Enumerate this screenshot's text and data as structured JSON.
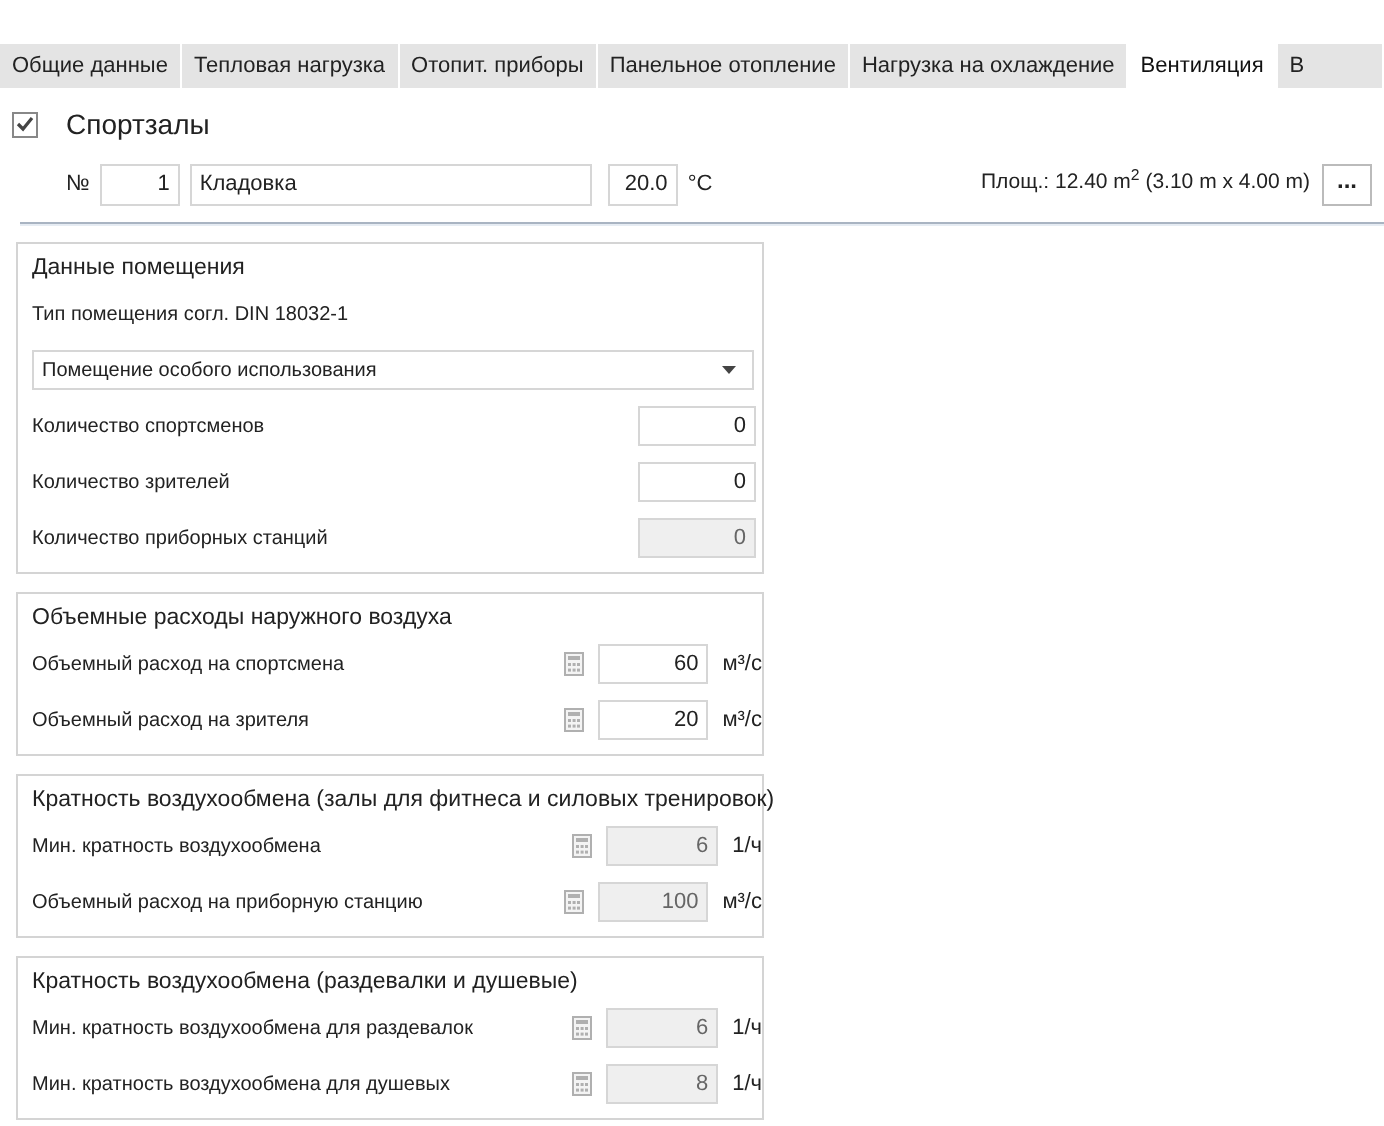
{
  "tabs": [
    {
      "label": "Общие данные",
      "selected": false
    },
    {
      "label": "Тепловая нагрузка",
      "selected": false
    },
    {
      "label": "Отопит. приборы",
      "selected": false
    },
    {
      "label": "Панельное отопление",
      "selected": false
    },
    {
      "label": "Нагрузка на охлаждение",
      "selected": false
    },
    {
      "label": "Вентиляция",
      "selected": true
    },
    {
      "label": "В",
      "selected": false
    }
  ],
  "category": {
    "label": "Спортзалы",
    "checked": true
  },
  "room": {
    "number_label": "№",
    "number": "1",
    "name": "Кладовка",
    "temperature": "20.0",
    "temperature_unit": "°C",
    "area": "Площ.: 12.40  m$^{2}$ (3.10 m x 4.00 m)",
    "more_button": "..."
  },
  "sections": [
    {
      "title": "Данные помещения",
      "rows": [
        {
          "kind": "text",
          "label": "Тип помещения согл. DIN 18032-1"
        },
        {
          "kind": "dropdown",
          "value": "Помещение особого использования"
        },
        {
          "kind": "number",
          "label": "Количество спортсменов",
          "value": "0",
          "disabled": false
        },
        {
          "kind": "number",
          "label": "Количество зрителей",
          "value": "0",
          "disabled": false
        },
        {
          "kind": "number",
          "label": "Количество приборных станций",
          "value": "0",
          "disabled": true
        }
      ]
    },
    {
      "title": "Объемные расходы наружного воздуха",
      "rows": [
        {
          "kind": "calc",
          "label": "Объемный расход на спортсмена",
          "value": "60",
          "unit": "м³/с",
          "disabled": false
        },
        {
          "kind": "calc",
          "label": "Объемный расход на зрителя",
          "value": "20",
          "unit": "м³/с",
          "disabled": false
        }
      ]
    },
    {
      "title": "Кратность воздухообмена (залы для фитнеса и силовых тренировок)",
      "rows": [
        {
          "kind": "calc",
          "label": "Мин. кратность воздухообмена",
          "value": "6",
          "unit": "1/ч",
          "disabled": true
        },
        {
          "kind": "calc",
          "label": "Объемный расход на приборную станцию",
          "value": "100",
          "unit": "м³/с",
          "disabled": true
        }
      ]
    },
    {
      "title": "Кратность воздухообмена (раздевалки и душевые)",
      "rows": [
        {
          "kind": "calc",
          "label": "Мин. кратность воздухообмена для раздевалок",
          "value": "6",
          "unit": "1/ч",
          "disabled": true
        },
        {
          "kind": "calc",
          "label": "Мин. кратность воздухообмена для душевых",
          "value": "8",
          "unit": "1/ч",
          "disabled": true
        }
      ]
    }
  ]
}
